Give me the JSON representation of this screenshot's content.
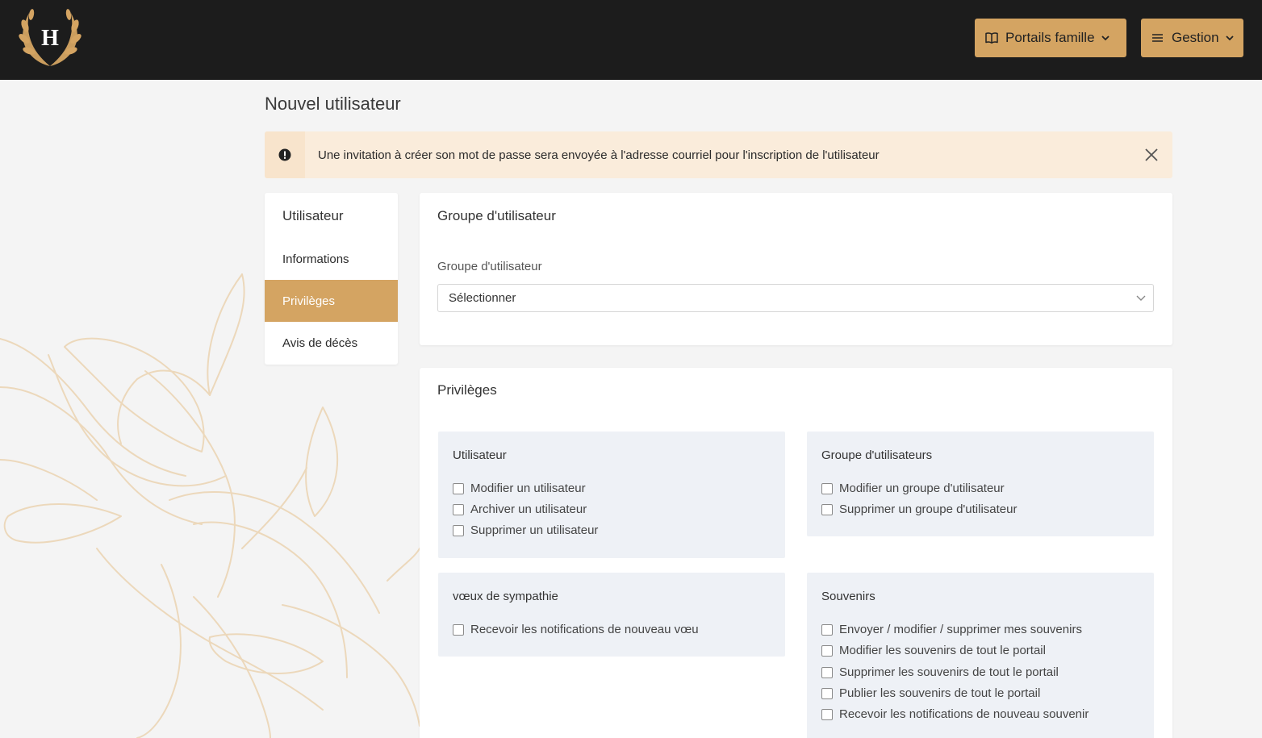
{
  "header": {
    "logo_letter": "H",
    "portails_label": "Portails famille",
    "gestion_label": "Gestion"
  },
  "page": {
    "title": "Nouvel utilisateur"
  },
  "alert": {
    "message": "Une invitation à créer son mot de passe sera envoyée à l'adresse courriel pour l'inscription de l'utilisateur"
  },
  "sidenav": {
    "title": "Utilisateur",
    "items": [
      {
        "label": "Informations"
      },
      {
        "label": "Privilèges"
      },
      {
        "label": "Avis de décès"
      }
    ]
  },
  "group_card": {
    "title": "Groupe d'utilisateur",
    "field_label": "Groupe d'utilisateur",
    "select_value": "Sélectionner"
  },
  "privileges": {
    "title": "Privilèges",
    "groups": [
      {
        "title": "Utilisateur",
        "items": [
          "Modifier un utilisateur",
          "Archiver un utilisateur",
          "Supprimer un utilisateur"
        ]
      },
      {
        "title": "Groupe d'utilisateurs",
        "items": [
          "Modifier un groupe d'utilisateur",
          "Supprimer un groupe d'utilisateur"
        ]
      },
      {
        "title": "vœux de sympathie",
        "items": [
          "Recevoir les notifications de nouveau vœu"
        ]
      },
      {
        "title": "Souvenirs",
        "items": [
          "Envoyer / modifier / supprimer mes souvenirs",
          "Modifier les souvenirs de tout le portail",
          "Supprimer les souvenirs de tout le portail",
          "Publier les souvenirs de tout le portail",
          "Recevoir les notifications de nouveau souvenir"
        ]
      }
    ]
  },
  "colors": {
    "accent": "#d4a462",
    "header_bg": "#1c1c1c",
    "alert_bg": "#faecdb",
    "group_bg": "#eef1f6"
  }
}
